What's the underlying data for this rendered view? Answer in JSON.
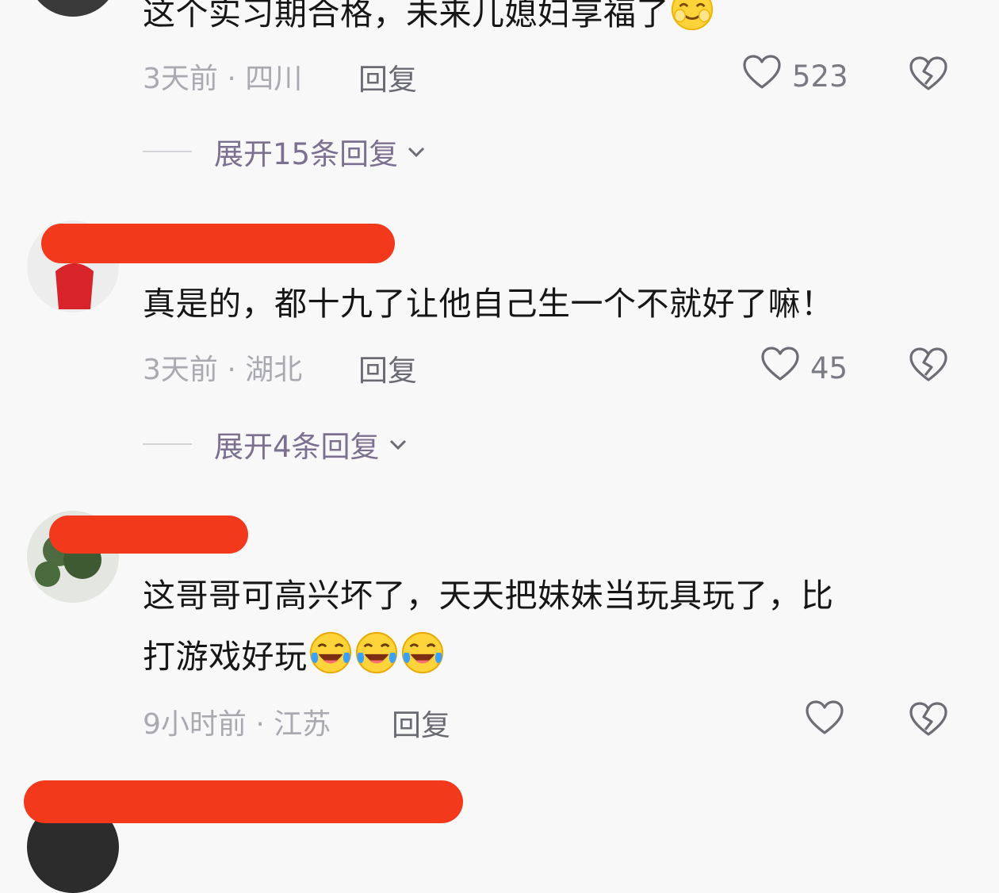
{
  "comments": [
    {
      "text": "这个实习期合格，未来儿媳妇享福了",
      "emoji": "smiling-face-emoji",
      "time": "3天前",
      "location": "四川",
      "reply_label": "回复",
      "likes": "523",
      "expand_label": "展开15条回复"
    },
    {
      "text": "真是的，都十九了让他自己生一个不就好了嘛！",
      "time": "3天前",
      "location": "湖北",
      "reply_label": "回复",
      "likes": "45",
      "expand_label": "展开4条回复"
    },
    {
      "text_line1": "这哥哥可高兴坏了，天天把妹妹当玩具玩了，比",
      "text_line2": "打游戏好玩",
      "emoji": "tears-of-joy-emoji",
      "time": "9小时前",
      "location": "江苏",
      "reply_label": "回复",
      "likes": ""
    }
  ],
  "separator": " · ",
  "colors": {
    "background": "#f8f8f9",
    "redaction": "#f2391c",
    "meta_text": "#a9a9b0",
    "expand_text": "#7b7090",
    "icon": "#6c6c74"
  },
  "icons": [
    "heart-outline-icon",
    "broken-heart-icon",
    "chevron-down-icon"
  ]
}
